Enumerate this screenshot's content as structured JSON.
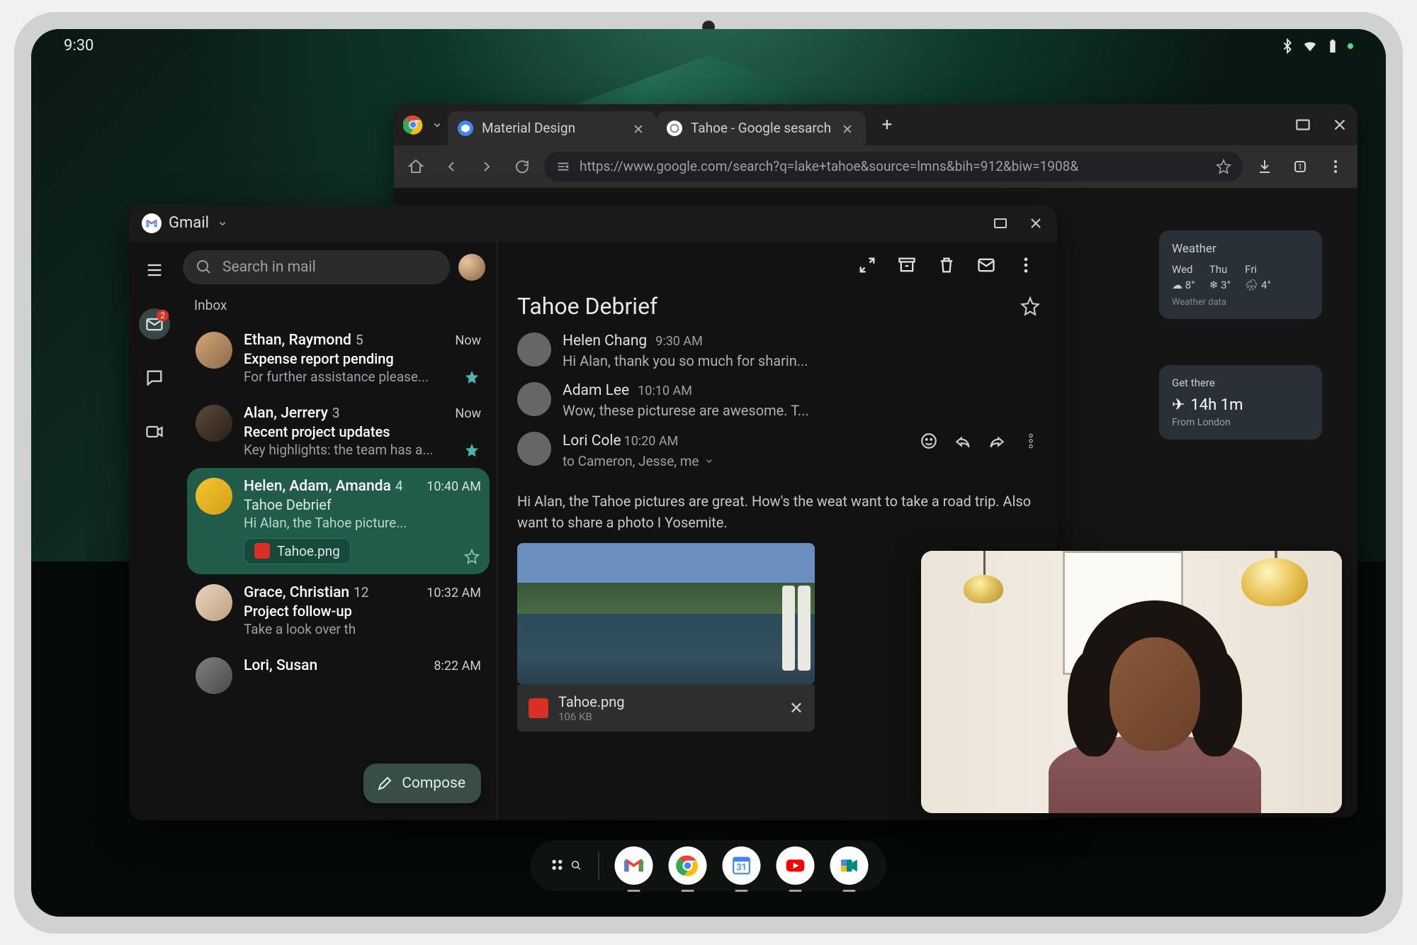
{
  "status": {
    "time": "9:30"
  },
  "chrome": {
    "tabs": [
      {
        "title": "Material Design"
      },
      {
        "title": "Tahoe - Google sesarch"
      }
    ],
    "url": "https://www.google.com/search?q=lake+tahoe&source=lmns&bih=912&biw=1908&",
    "weather": {
      "title": "Weather",
      "days": [
        {
          "label": "Wed",
          "temp": "8°"
        },
        {
          "label": "Thu",
          "temp": "3°"
        },
        {
          "label": "Fri",
          "temp": "4°"
        }
      ],
      "footer": "Weather data"
    },
    "route": {
      "title": "Get there",
      "time": "14h 1m",
      "from": "From London"
    }
  },
  "gmail": {
    "app_title": "Gmail",
    "search_placeholder": "Search in mail",
    "inbox_label": "Inbox",
    "rail_badge": "2",
    "threads": [
      {
        "senders": "Ethan, Raymond",
        "count": "5",
        "time": "Now",
        "subject": "Expense report pending",
        "snippet": "For further assistance please..."
      },
      {
        "senders": "Alan, Jerrery",
        "count": "3",
        "time": "Now",
        "subject": "Recent project updates",
        "snippet": "Key highlights: the team has a..."
      },
      {
        "senders": "Helen, Adam, Amanda",
        "count": "4",
        "time": "10:40 AM",
        "subject": "Tahoe Debrief",
        "snippet": "Hi Alan, the Tahoe picture...",
        "attachment": "Tahoe.png"
      },
      {
        "senders": "Grace, Christian",
        "count": "12",
        "time": "10:32 AM",
        "subject": "Project follow-up",
        "snippet": "Take a look over th"
      },
      {
        "senders": "Lori, Susan",
        "count": "",
        "time": "8:22 AM",
        "subject": "",
        "snippet": ""
      }
    ],
    "compose_label": "Compose",
    "reader": {
      "title": "Tahoe Debrief",
      "messages": [
        {
          "from": "Helen Chang",
          "time": "9:30 AM",
          "snippet": "Hi Alan, thank you so much for sharin..."
        },
        {
          "from": "Adam Lee",
          "time": "10:10 AM",
          "snippet": "Wow, these picturese are awesome. T..."
        },
        {
          "from": "Lori Cole",
          "time": "10:20 AM",
          "to": "to Cameron, Jesse, me"
        }
      ],
      "body_text": "Hi Alan, the Tahoe pictures are great. How's the weat want to take a road trip. Also want to share a photo I Yosemite.",
      "attachment": {
        "name": "Tahoe.png",
        "size": "106 KB"
      }
    }
  }
}
